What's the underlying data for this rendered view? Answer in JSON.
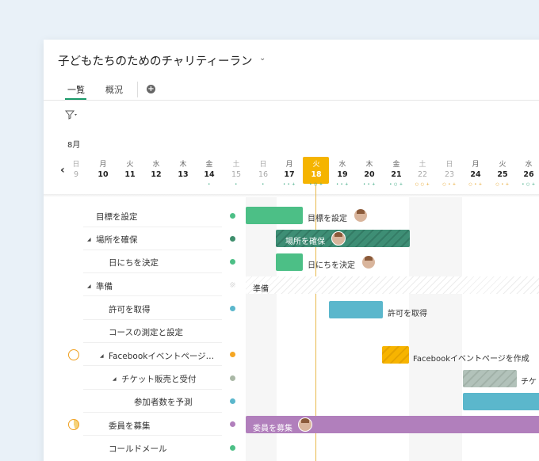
{
  "project": {
    "title": "子どもたちのためのチャリティーラン"
  },
  "tabs": [
    {
      "label": "一覧"
    },
    {
      "label": "概況"
    }
  ],
  "timeline": {
    "month": "8月",
    "days": [
      {
        "dow": "日",
        "num": "9",
        "dots": ""
      },
      {
        "dow": "月",
        "num": "10",
        "dots": ""
      },
      {
        "dow": "火",
        "num": "11",
        "dots": ""
      },
      {
        "dow": "水",
        "num": "12",
        "dots": ""
      },
      {
        "dow": "木",
        "num": "13",
        "dots": ""
      },
      {
        "dow": "金",
        "num": "14",
        "dots": "•"
      },
      {
        "dow": "土",
        "num": "15",
        "dots": "•"
      },
      {
        "dow": "日",
        "num": "16",
        "dots": "•"
      },
      {
        "dow": "月",
        "num": "17",
        "dots": "• • +"
      },
      {
        "dow": "火",
        "num": "18",
        "dots": "• ○ +"
      },
      {
        "dow": "水",
        "num": "19",
        "dots": "• • +"
      },
      {
        "dow": "木",
        "num": "20",
        "dots": "• • +"
      },
      {
        "dow": "金",
        "num": "21",
        "dots": "• ○ +"
      },
      {
        "dow": "土",
        "num": "22",
        "dots": "○ ○ +"
      },
      {
        "dow": "日",
        "num": "23",
        "dots": "○ • +"
      },
      {
        "dow": "月",
        "num": "24",
        "dots": "○ • +"
      },
      {
        "dow": "火",
        "num": "25",
        "dots": "○ • +"
      },
      {
        "dow": "水",
        "num": "26",
        "dots": "• ○ +"
      }
    ]
  },
  "tasks": [
    {
      "name": "目標を設定",
      "status_color": "#4cbf86"
    },
    {
      "name": "場所を確保",
      "status_color": "#3e8e6c"
    },
    {
      "name": "日にちを決定",
      "status_color": "#4cbf86"
    },
    {
      "name": "準備",
      "status_color": "#cccccc"
    },
    {
      "name": "許可を取得",
      "status_color": "#5bb7cc"
    },
    {
      "name": "コースの測定と設定",
      "status_color": ""
    },
    {
      "name": "Facebookイベントページ…",
      "status_color": "#f5a623"
    },
    {
      "name": "チケット販売と受付",
      "status_color": "#aab8a6"
    },
    {
      "name": "参加者数を予測",
      "status_color": "#5bb7cc"
    },
    {
      "name": "委員を募集",
      "status_color": "#b17fbc"
    },
    {
      "name": "コールドメール",
      "status_color": "#4cbf86"
    }
  ],
  "bars": {
    "goal": "目標を設定",
    "venue": "場所を確保",
    "date": "日にちを決定",
    "prep": "準備",
    "permit": "許可を取得",
    "facebook": "Facebookイベントページを作成",
    "ticket": "チケ",
    "committee": "委員を募集"
  },
  "colors": {
    "accent": "#1a9a6a",
    "today": "#f5b400",
    "green": "#4cbf86",
    "dark_green": "#3e8e6c",
    "blue": "#5bb7cc",
    "purple": "#b17fbc",
    "orange": "#f5a623"
  }
}
